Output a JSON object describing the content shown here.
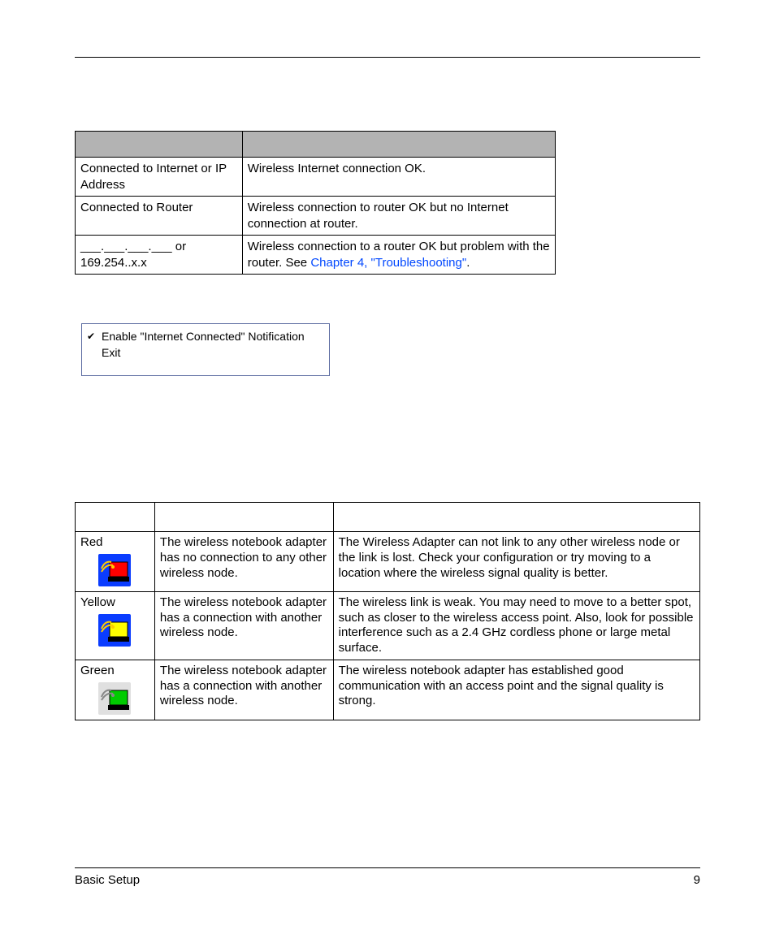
{
  "table1": {
    "rows": [
      {
        "c1": "Connected to Internet or IP Address",
        "c2": "Wireless Internet connection OK."
      },
      {
        "c1": "Connected to Router",
        "c2": "Wireless connection to router OK but no Internet connection at router."
      },
      {
        "c1": "___.___.___.___ or 169.254..x.x",
        "c2_pre": "Wireless connection to a router OK but problem with the router. See ",
        "c2_link": "Chapter 4, \"Troubleshooting\"",
        "c2_post": "."
      }
    ]
  },
  "menu": {
    "item1": "Enable \"Internet Connected\" Notification",
    "item2": "Exit"
  },
  "table2": {
    "rows": [
      {
        "color": "Red",
        "condition": "The wireless notebook adapter has no connection to any other wireless node.",
        "desc": "The Wireless Adapter can not link to any other wireless node or the link is lost. Check your configuration or try moving to a location where the wireless signal quality is better."
      },
      {
        "color": "Yellow",
        "condition": "The wireless notebook adapter has a connection with another wireless node.",
        "desc": "The wireless link is weak. You may need to move to a better spot, such as closer to the wireless access point. Also, look for possible interference such as a 2.4 GHz cordless phone or large metal surface."
      },
      {
        "color": "Green",
        "condition": "The wireless notebook adapter has a connection with another wireless node.",
        "desc": "The wireless notebook adapter has established good communication with an access point and the signal quality is strong."
      }
    ]
  },
  "footer": {
    "left": "Basic Setup",
    "right": "9"
  }
}
